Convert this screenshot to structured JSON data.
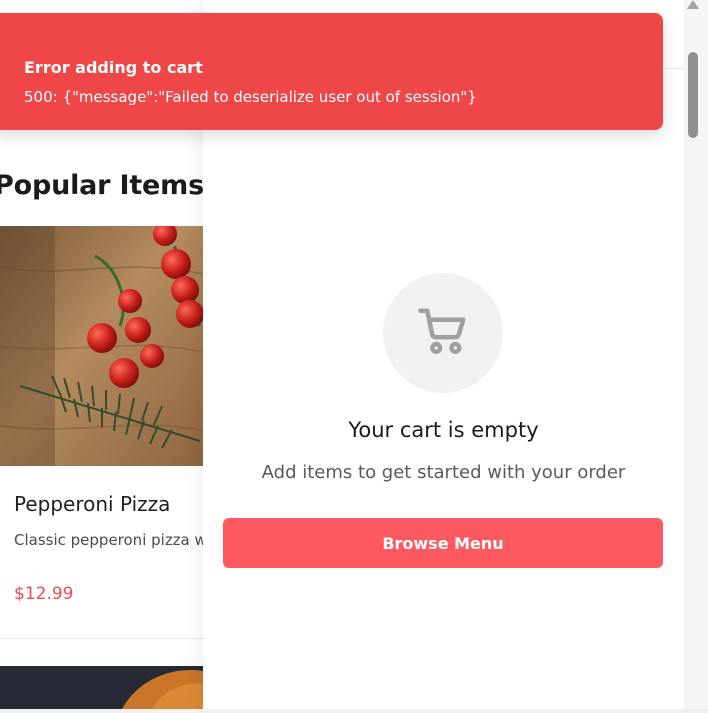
{
  "page": {
    "section_title": "Popular Items",
    "items": [
      {
        "name": "Pepperoni Pizza",
        "description": "Classic pepperoni pizza with mozzarella cheese",
        "price": "$12.99"
      }
    ]
  },
  "cart": {
    "empty_icon": "cart-icon",
    "empty_title": "Your cart is empty",
    "empty_subtitle": "Add items to get started with your order",
    "browse_label": "Browse Menu"
  },
  "toast": {
    "title": "Error adding to cart",
    "message": "500: {\"message\":\"Failed to deserialize user out of session\"}"
  },
  "colors": {
    "accent": "#fc5a60",
    "price": "#ef4b52",
    "error": "#ef4648"
  }
}
